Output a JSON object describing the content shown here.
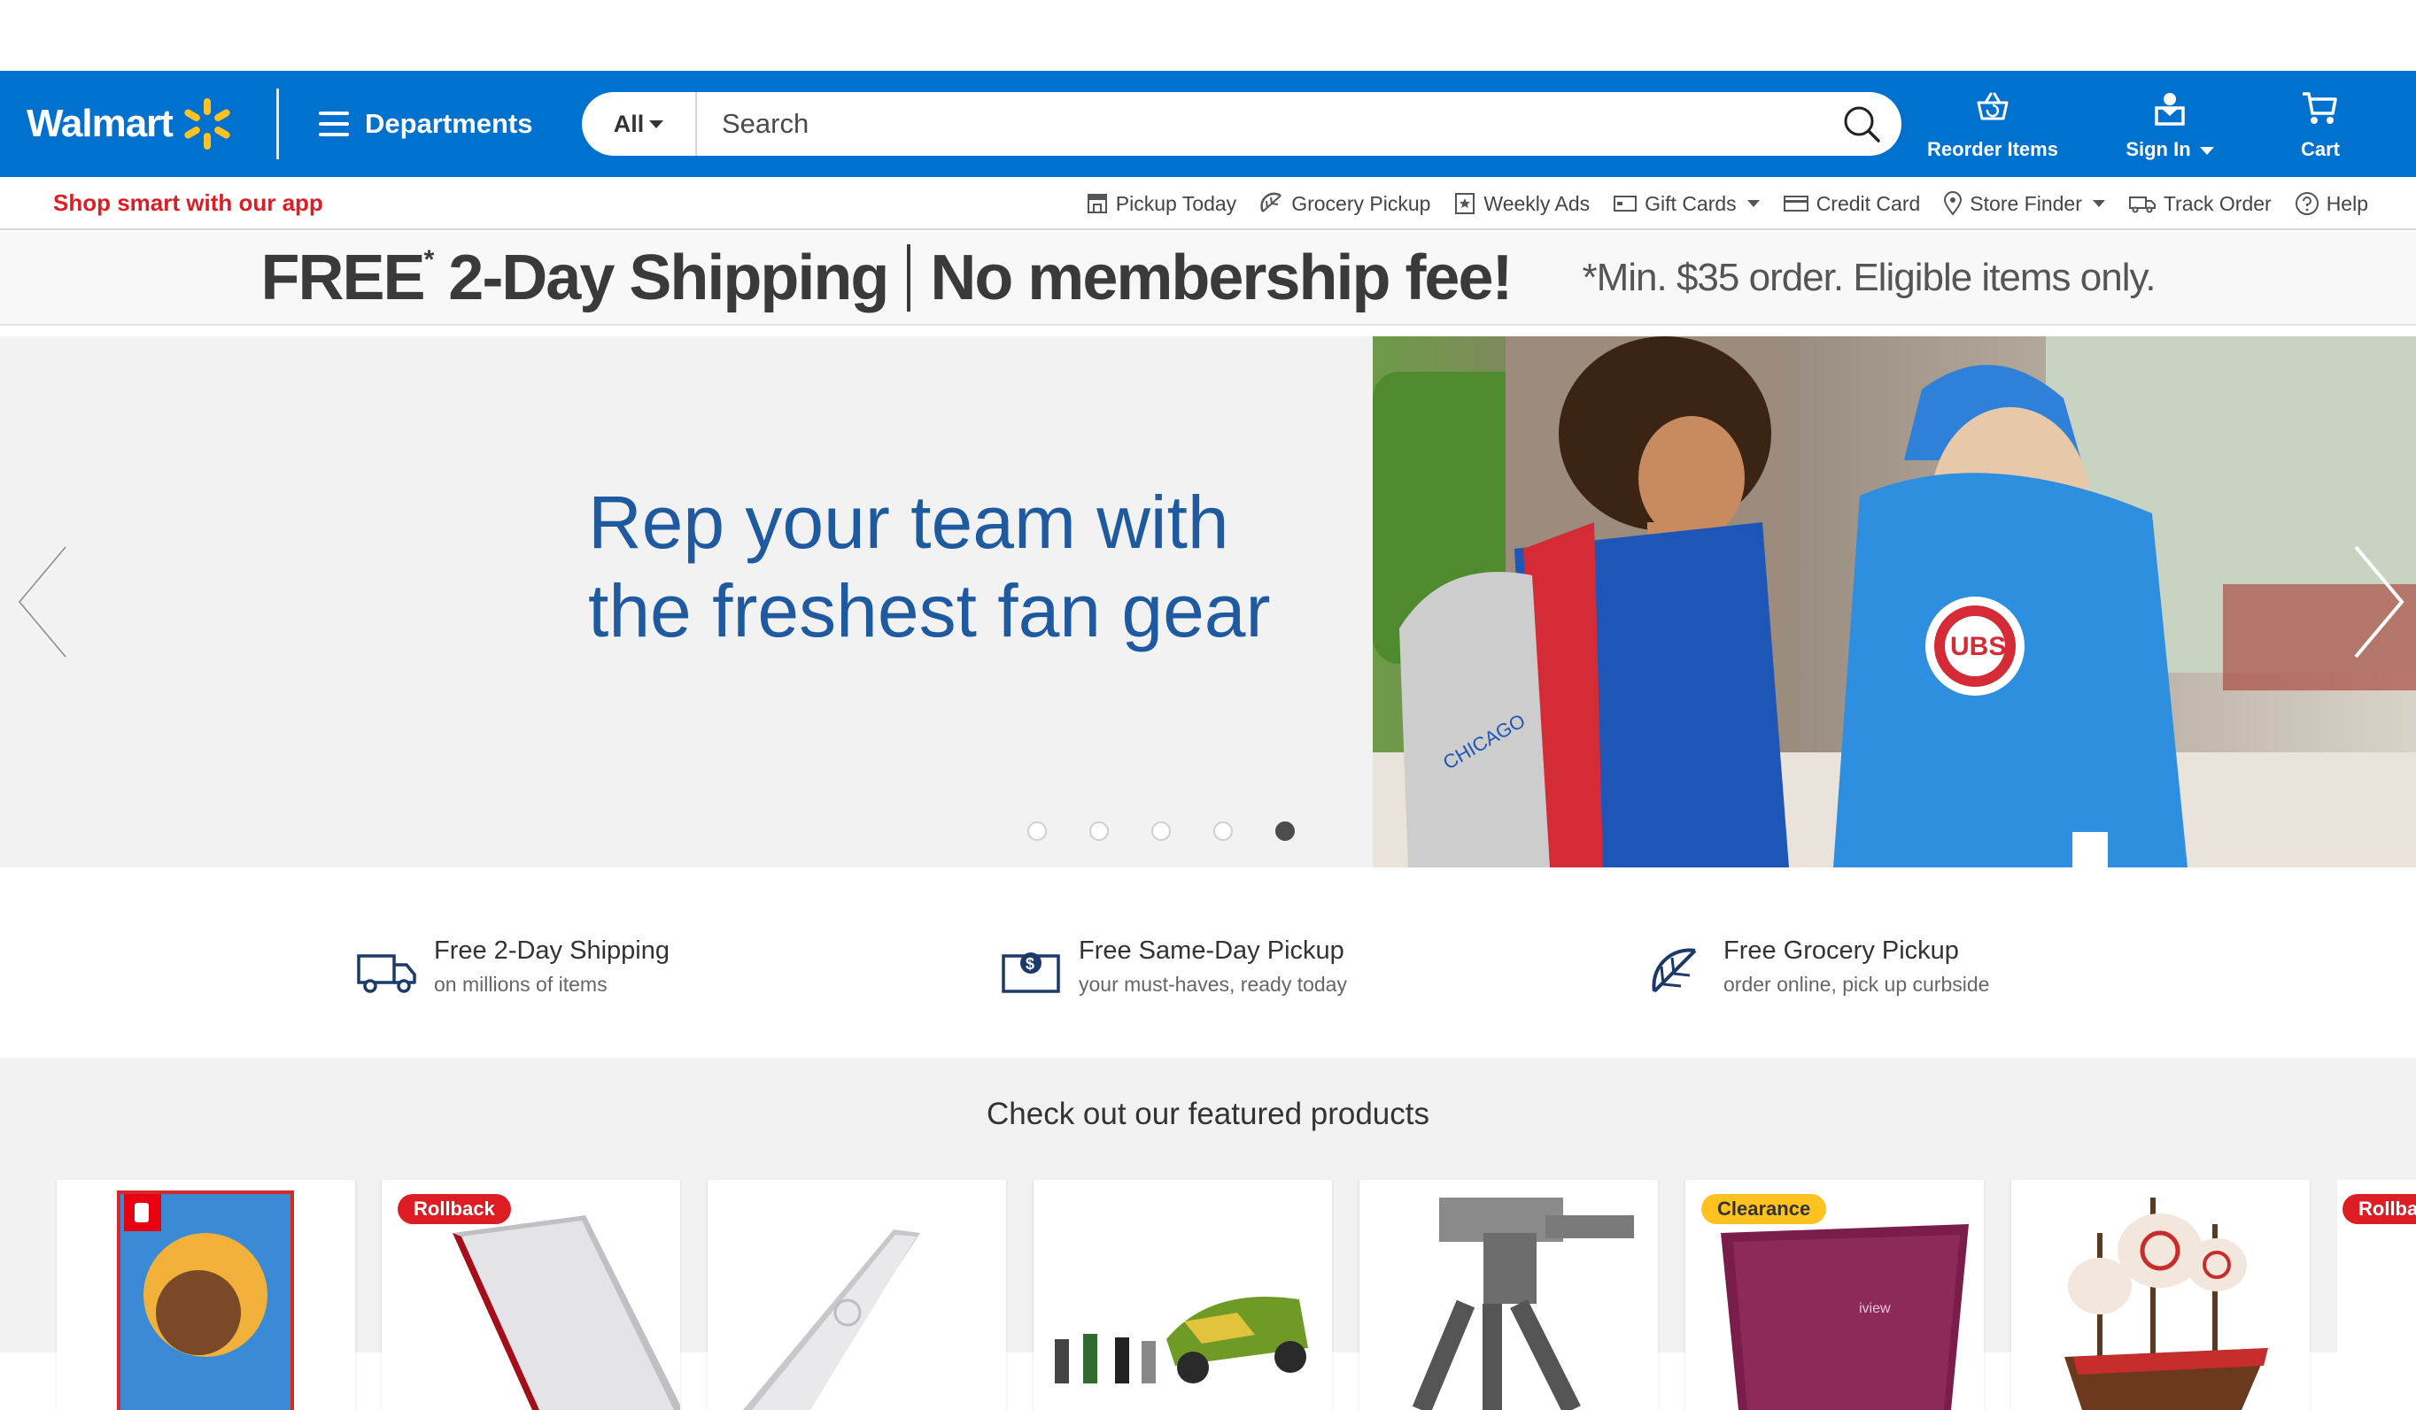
{
  "header": {
    "logo_text": "Walmart",
    "departments_label": "Departments",
    "search": {
      "scope": "All",
      "placeholder": "Search"
    },
    "reorder_label": "Reorder Items",
    "signin_label": "Sign In",
    "cart_label": "Cart",
    "brand_color": "#0071ce",
    "spark_color": "#ffc220"
  },
  "subnav": {
    "app_link": "Shop smart with our app",
    "links": [
      {
        "label": "Pickup Today",
        "icon": "store-icon"
      },
      {
        "label": "Grocery Pickup",
        "icon": "grocery-icon"
      },
      {
        "label": "Weekly Ads",
        "icon": "ad-icon"
      },
      {
        "label": "Gift Cards",
        "icon": "gift-card-icon",
        "dropdown": true
      },
      {
        "label": "Credit Card",
        "icon": "credit-card-icon"
      },
      {
        "label": "Store Finder",
        "icon": "location-pin-icon",
        "dropdown": true
      },
      {
        "label": "Track Order",
        "icon": "truck-icon"
      },
      {
        "label": "Help",
        "icon": "help-icon"
      }
    ]
  },
  "shipping_banner": {
    "free": "FREE",
    "asterisk": "*",
    "two_day": "2-Day Shipping",
    "no_fee": "No membership fee!",
    "fine_print": "*Min. $35 order. Eligible items only."
  },
  "hero": {
    "line1": "Rep your team with",
    "line2": "the freshest fan gear",
    "slide_count": 5,
    "active_slide": 5,
    "text_color": "#1f5aa0"
  },
  "value_props": [
    {
      "title": "Free 2-Day Shipping",
      "subtitle": "on millions of items",
      "icon": "truck-icon"
    },
    {
      "title": "Free Same-Day Pickup",
      "subtitle": "your must-haves, ready today",
      "icon": "pickup-box-icon"
    },
    {
      "title": "Free Grocery Pickup",
      "subtitle": "order online, pick up curbside",
      "icon": "lemon-slice-icon"
    }
  ],
  "featured": {
    "title": "Check out our featured products",
    "badges": {
      "rollback": "Rollback",
      "clearance": "Clearance",
      "rollback_partial": "Rollbac"
    },
    "products": [
      {
        "name": "game-case",
        "badge": ""
      },
      {
        "name": "silver-laptop",
        "badge": "Rollback"
      },
      {
        "name": "silver-laptop-2",
        "badge": ""
      },
      {
        "name": "toy-car-set",
        "badge": ""
      },
      {
        "name": "robot-toy",
        "badge": ""
      },
      {
        "name": "purple-laptop",
        "badge": "Clearance"
      },
      {
        "name": "ship-toy",
        "badge": ""
      },
      {
        "name": "partial-product",
        "badge": "Rollbac"
      }
    ]
  }
}
